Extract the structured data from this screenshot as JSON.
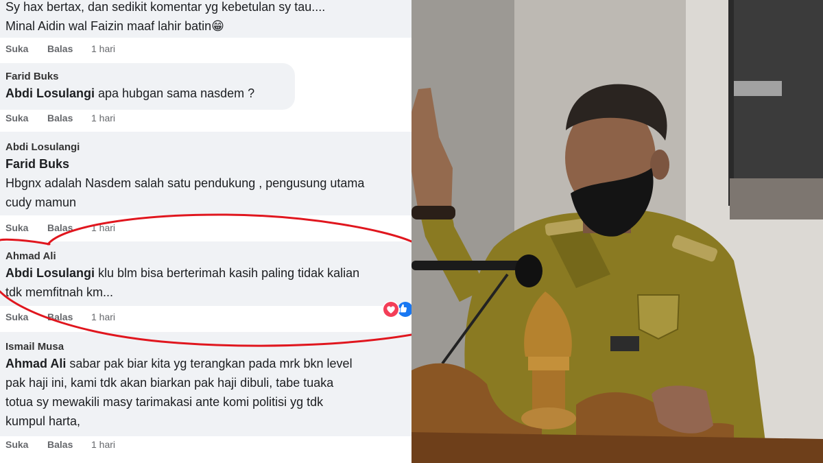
{
  "comments": [
    {
      "body": "Sy hax bertax, dan sedikit komentar yg kebetulan sy tau....\nMinal Aidin wal Faizin maaf lahir batin😁",
      "like": "Suka",
      "reply": "Balas",
      "time": "1 hari"
    },
    {
      "author": "Farid Buks",
      "mention": "Abdi Losulangi",
      "body": " apa hubgan sama nasdem ?",
      "like": "Suka",
      "reply": "Balas",
      "time": "1 hari"
    },
    {
      "author": "Abdi Losulangi",
      "mention": "Farid Buks",
      "body": "Hbgnx adalah Nasdem salah satu pendukung , pengusung utama\ncudy mamun",
      "like": "Suka",
      "reply": "Balas",
      "time": "1 hari"
    },
    {
      "author": "Ahmad Ali",
      "mention": "Abdi Losulangi",
      "body": " klu blm bisa berterimah kasih paling tidak kalian\ntdk memfitnah km...",
      "like": "Suka",
      "reply": "Balas",
      "time": "1 hari"
    },
    {
      "author": "Ismail Musa",
      "mention": "Ahmad Ali",
      "body": " sabar pak biar kita yg terangkan pada mrk bkn level\npak haji ini, kami tdk akan biarkan pak haji dibuli, tabe tuaka\ntotua sy mewakili masy tarimakasi ante komi politisi yg tdk\nkumpul harta,",
      "like": "Suka",
      "reply": "Balas",
      "time": "1 hari"
    }
  ],
  "colors": {
    "bubble": "#f0f2f5",
    "annotation": "#e0161e",
    "uniform": "#8a7a22"
  },
  "icons": {
    "reaction_heart": "heart-icon",
    "reaction_like": "like-icon"
  }
}
